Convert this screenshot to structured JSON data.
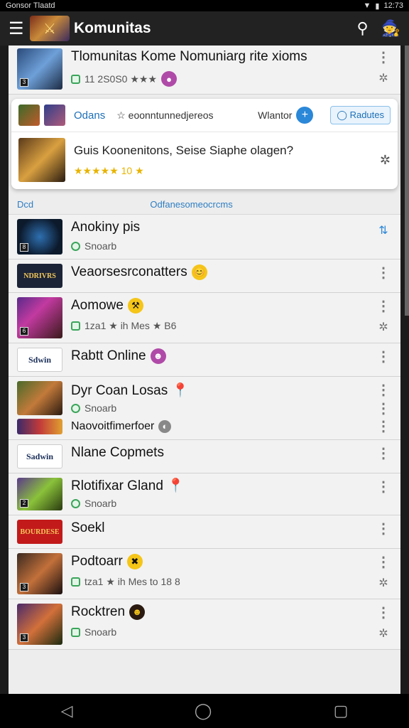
{
  "status": {
    "left": "Gonsor Tlaatd",
    "time": "12:73"
  },
  "appbar": {
    "title": "Komunitas",
    "menu_icon": "menu-icon",
    "search_icon": "search-icon"
  },
  "header_row": {
    "title": "Tlomunitas Kome Nomuniarg rite xioms",
    "meta": "11 2S0S0 ★★★"
  },
  "featured": {
    "tab": "Odans",
    "subtitle": "eoonntunnedjereos",
    "warrior": "Wlantor",
    "button": "Radutes",
    "question": "Guis Koonenitons, Seise Siaphe olagen?",
    "stars": "★★★★★ 10 ★"
  },
  "section": {
    "left": "Dcd",
    "center": "Odfanesomeocrcms"
  },
  "communities": [
    {
      "name": "Anokiny pis",
      "meta": "Snoarb"
    },
    {
      "name": "Veaorsesrconatters",
      "meta": ""
    },
    {
      "name": "Aomowe",
      "meta": "1za1 ★ ih Mes ★ B6"
    },
    {
      "name": "Rabtt Online",
      "meta": ""
    },
    {
      "name": "Dyr Coan Losas",
      "meta": "Snoarb"
    },
    {
      "name": "Naovoitfimerfoer",
      "meta": ""
    },
    {
      "name": "Nlane Copmets",
      "meta": ""
    },
    {
      "name": "Rlotifixar Gland",
      "meta": "Snoarb"
    },
    {
      "name": "Soekl",
      "meta": ""
    },
    {
      "name": "Podtoarr",
      "meta": "tza1 ★ ih Mes to 18 8"
    },
    {
      "name": "Rocktren",
      "meta": "Snoarb"
    }
  ],
  "thumb_labels": {
    "nw": "NDRIVRS",
    "sdwin1": "Sdwin",
    "sdwin2": "Sadwin",
    "banner": "BOURDESE"
  }
}
